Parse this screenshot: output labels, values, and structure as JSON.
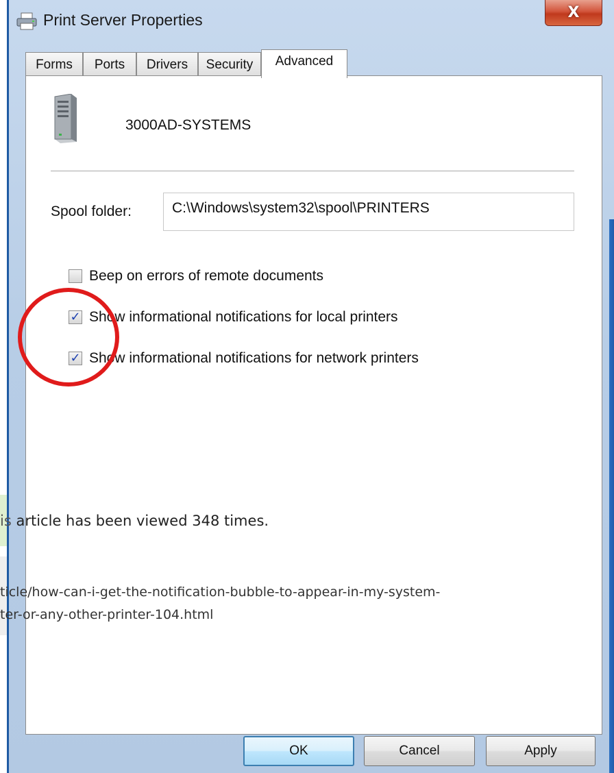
{
  "window": {
    "title": "Print Server Properties",
    "close_glyph": "X"
  },
  "tabs": [
    {
      "label": "Forms",
      "active": false
    },
    {
      "label": "Ports",
      "active": false
    },
    {
      "label": "Drivers",
      "active": false
    },
    {
      "label": "Security",
      "active": false
    },
    {
      "label": "Advanced",
      "active": true
    }
  ],
  "server": {
    "name": "3000AD-SYSTEMS",
    "icon": "server-tower-icon"
  },
  "spool": {
    "label": "Spool folder:",
    "value": "C:\\Windows\\system32\\spool\\PRINTERS"
  },
  "options": [
    {
      "label": "Beep on errors of remote documents",
      "checked": false
    },
    {
      "label": "Show informational notifications for local printers",
      "checked": true
    },
    {
      "label": "Show informational notifications for network printers",
      "checked": true
    }
  ],
  "overlay": {
    "views_prefix": "is",
    "views_text": " article has been viewed 348 times.",
    "url_line1": "ticle/how-can-i-get-the-notification-bubble-to-appear-in-my-system-",
    "url_line2": "ter-or-any-other-printer-104.html"
  },
  "buttons": {
    "ok": "OK",
    "cancel": "Cancel",
    "apply": "Apply"
  },
  "colors": {
    "annotation_circle": "#e01b1b",
    "checkmark": "#1b3fb0",
    "title_bar": "#c7d9ee",
    "close_button": "#c0391d"
  }
}
